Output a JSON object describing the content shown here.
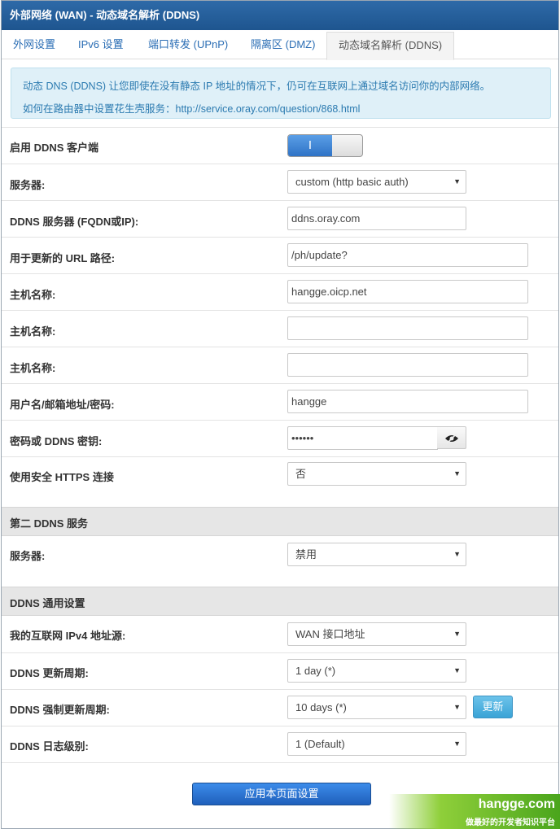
{
  "window": {
    "title": "外部网络 (WAN) - 动态域名解析 (DDNS)"
  },
  "tabs": [
    {
      "label": "外网设置"
    },
    {
      "label": "IPv6 设置"
    },
    {
      "label": "端口转发 (UPnP)"
    },
    {
      "label": "隔离区 (DMZ)"
    },
    {
      "label": "动态域名解析 (DDNS)",
      "active": true
    }
  ],
  "info": {
    "line1": "动态 DNS (DDNS) 让您即使在没有静态 IP 地址的情况下，仍可在互联网上通过域名访问你的内部网络。",
    "line2": "如何在路由器中设置花生壳服务：http://service.oray.com/question/868.html"
  },
  "form": {
    "enable_label": "启用 DDNS 客户端",
    "enable_toggle_text": "I",
    "server_label": "服务器:",
    "server_value": "custom (http basic auth)",
    "ddns_server_label": "DDNS 服务器 (FQDN或IP):",
    "ddns_server_value": "ddns.oray.com",
    "url_path_label": "用于更新的 URL 路径:",
    "url_path_value": "/ph/update?",
    "hostname1_label": "主机名称:",
    "hostname1_value": "hangge.oicp.net",
    "hostname2_label": "主机名称:",
    "hostname2_value": "",
    "hostname3_label": "主机名称:",
    "hostname3_value": "",
    "user_label": "用户名/邮箱地址/密码:",
    "user_value": "hangge",
    "password_label": "密码或 DDNS 密钥:",
    "password_value": "••••••",
    "https_label": "使用安全 HTTPS 连接",
    "https_value": "否"
  },
  "second": {
    "title": "第二 DDNS 服务",
    "server_label": "服务器:",
    "server_value": "禁用"
  },
  "general": {
    "title": "DDNS 通用设置",
    "source_label": "我的互联网 IPv4 地址源:",
    "source_value": "WAN 接口地址",
    "period_label": "DDNS 更新周期:",
    "period_value": "1 day (*)",
    "force_label": "DDNS 强制更新周期:",
    "force_value": "10 days (*)",
    "update_button": "更新",
    "log_label": "DDNS 日志级别:",
    "log_value": "1 (Default)"
  },
  "apply_button": "应用本页面设置",
  "watermark": {
    "title": "hangge.com",
    "subtitle": "做最好的开发者知识平台"
  },
  "colors": {
    "titlebar": "#1e558f",
    "link": "#2a6db4",
    "apply": "#1f5fbb",
    "update": "#3aa3d6"
  }
}
